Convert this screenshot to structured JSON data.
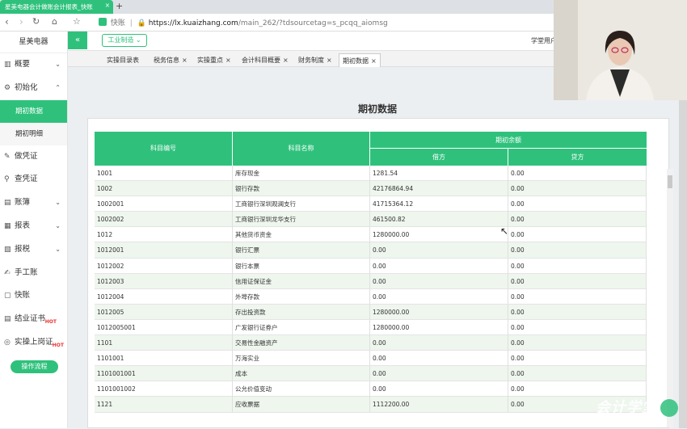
{
  "browser": {
    "tab_title": "星美电器会计做账会计报表_快账",
    "tab_close": "×",
    "new_tab": "+",
    "secure_label": "快账",
    "url_host": "https://lx.kuaizhang.com",
    "url_path": "/main_262/?tdsourcetag=s_pcqq_aiomsg"
  },
  "sidebar": {
    "brand": "星美电器",
    "items": [
      {
        "label": "概要",
        "icon": "▥",
        "chevron": "⌄"
      },
      {
        "label": "初始化",
        "icon": "⚙",
        "chevron": "⌃"
      },
      {
        "label": "做凭证",
        "icon": "✎"
      },
      {
        "label": "查凭证",
        "icon": "🔍"
      },
      {
        "label": "账簿",
        "icon": "▤",
        "chevron": "⌄"
      },
      {
        "label": "报表",
        "icon": "▦",
        "chevron": "⌄"
      },
      {
        "label": "报税",
        "icon": "▧",
        "chevron": "⌄"
      },
      {
        "label": "手工账",
        "icon": "✍"
      },
      {
        "label": "快账",
        "icon": "▢"
      },
      {
        "label": "结业证书",
        "icon": "▤",
        "badge": "HOT"
      },
      {
        "label": "实操上岗证",
        "icon": "◎",
        "badge": "HOT"
      }
    ],
    "subitems": [
      {
        "label": "期初数据"
      },
      {
        "label": "期初明细"
      }
    ],
    "flow_button": "操作流程"
  },
  "topbar": {
    "collapse": "«",
    "industry": "工业制造 ⌄",
    "user": "学堂用户"
  },
  "page_tabs": [
    {
      "label": "实操目录表"
    },
    {
      "label": "税务信息",
      "close": "×"
    },
    {
      "label": "实操重点",
      "close": "×"
    },
    {
      "label": "会计科目概要",
      "close": "×"
    },
    {
      "label": "财务制度",
      "close": "×"
    },
    {
      "label": "期初数据",
      "close": "×"
    }
  ],
  "page_title": "期初数据",
  "table": {
    "headers": {
      "code": "科目编号",
      "name": "科目名称",
      "balance": "期初余额",
      "debit": "借方",
      "credit": "贷方"
    },
    "rows": [
      {
        "code": "1001",
        "name": "库存现金",
        "debit": "1281.54",
        "credit": "0.00"
      },
      {
        "code": "1002",
        "name": "银行存款",
        "debit": "42176864.94",
        "credit": "0.00"
      },
      {
        "code": "1002001",
        "name": "工商银行深圳观澜支行",
        "debit": "41715364.12",
        "credit": "0.00"
      },
      {
        "code": "1002002",
        "name": "工商银行深圳龙华支行",
        "debit": "461500.82",
        "credit": "0.00"
      },
      {
        "code": "1012",
        "name": "其他货币资金",
        "debit": "1280000.00",
        "credit": "0.00"
      },
      {
        "code": "1012001",
        "name": "银行汇票",
        "debit": "0.00",
        "credit": "0.00"
      },
      {
        "code": "1012002",
        "name": "银行本票",
        "debit": "0.00",
        "credit": "0.00"
      },
      {
        "code": "1012003",
        "name": "信用证保证金",
        "debit": "0.00",
        "credit": "0.00"
      },
      {
        "code": "1012004",
        "name": "外埠存款",
        "debit": "0.00",
        "credit": "0.00"
      },
      {
        "code": "1012005",
        "name": "存出投资款",
        "debit": "1280000.00",
        "credit": "0.00"
      },
      {
        "code": "1012005001",
        "name": "广发银行证券户",
        "debit": "1280000.00",
        "credit": "0.00"
      },
      {
        "code": "1101",
        "name": "交易性金融资产",
        "debit": "0.00",
        "credit": "0.00"
      },
      {
        "code": "1101001",
        "name": "万海实业",
        "debit": "0.00",
        "credit": "0.00"
      },
      {
        "code": "1101001001",
        "name": "成本",
        "debit": "0.00",
        "credit": "0.00"
      },
      {
        "code": "1101001002",
        "name": "公允价值变动",
        "debit": "0.00",
        "credit": "0.00"
      },
      {
        "code": "1121",
        "name": "应收票据",
        "debit": "1112200.00",
        "credit": "0.00"
      }
    ]
  },
  "watermark": "会计学堂"
}
